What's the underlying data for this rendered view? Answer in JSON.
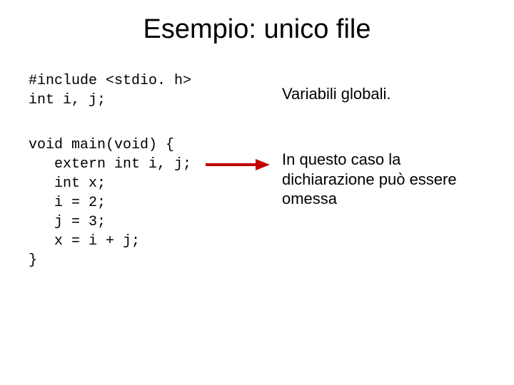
{
  "title": "Esempio: unico file",
  "code": {
    "block1": "#include <stdio. h>\nint i, j;",
    "block2": "void main(void) {\n   extern int i, j;\n   int x;\n   i = 2;\n   j = 3;\n   x = i + j;\n}"
  },
  "notes": {
    "n1": "Variabili globali.",
    "n2": "In questo caso la dichiarazione può essere omessa"
  },
  "colors": {
    "arrow": "#c00000"
  }
}
